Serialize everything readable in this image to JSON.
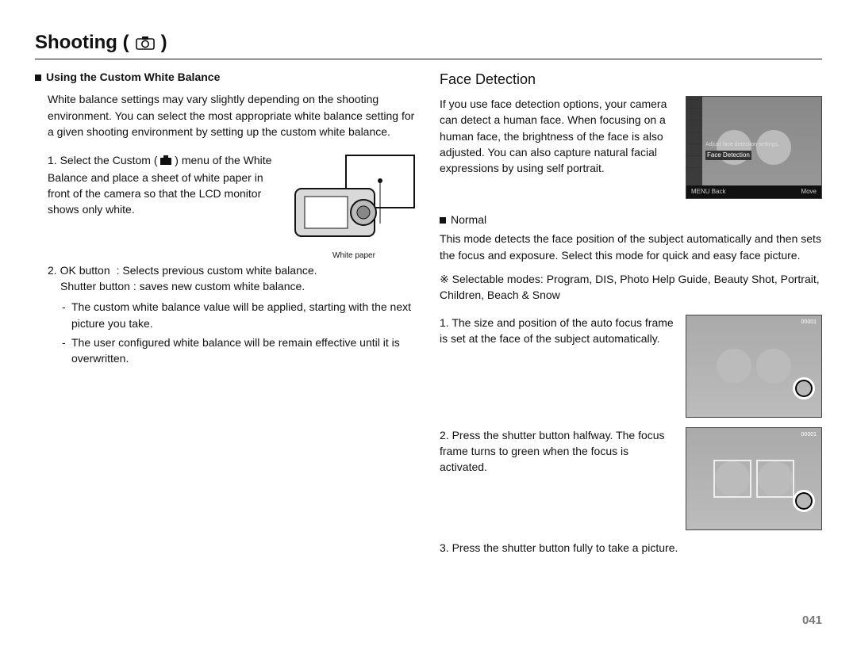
{
  "title": "Shooting (",
  "title_suffix": ")",
  "left": {
    "subhead": "Using the Custom White Balance",
    "intro": "White balance settings may vary slightly depending on the shooting environment. You can select the most appropriate white balance setting for a given shooting environment by setting up the custom white balance.",
    "step1_a": "Select the Custom (",
    "step1_b": ") menu of the White Balance and place a sheet of white paper in front of the camera so that the LCD monitor shows only white.",
    "step2_lead": "OK button",
    "step2_col": ": Selects previous custom white balance.",
    "shutter_line": "Shutter button : saves new custom white balance.",
    "bul1": "The custom white balance value will be applied, starting with the next picture you take.",
    "bul2": "The user configured white balance will be remain effective until it is overwritten.",
    "fig_caption": "White paper"
  },
  "right": {
    "section": "Face Detection",
    "intro": "If you use face detection options, your camera can detect a human face. When focusing on a human face, the brightness of the face is also adjusted. You can also capture natural facial expressions by using self portrait.",
    "normal_label": "Normal",
    "normal_desc": "This mode detects the face position of the subject automatically and then sets the focus and exposure. Select this mode for quick and easy face picture.",
    "modes_label": "※ Selectable modes:",
    "modes_value": "Program, DIS, Photo Help Guide, Beauty Shot, Portrait, Children, Beach & Snow",
    "step1": "The size and position of the auto focus frame is set at the face of the subject automatically.",
    "step2": "Press the shutter button halfway. The focus frame turns to green when the focus is activated.",
    "step3": "Press the shutter button fully to take a picture.",
    "shot1": {
      "label1": "Adjust face detection settings.",
      "label2": "Face Detection",
      "bar_left": "MENU  Back",
      "bar_right": "Move"
    },
    "shot_top_left": "",
    "shot_top_right": "00001"
  },
  "page_number": "041"
}
